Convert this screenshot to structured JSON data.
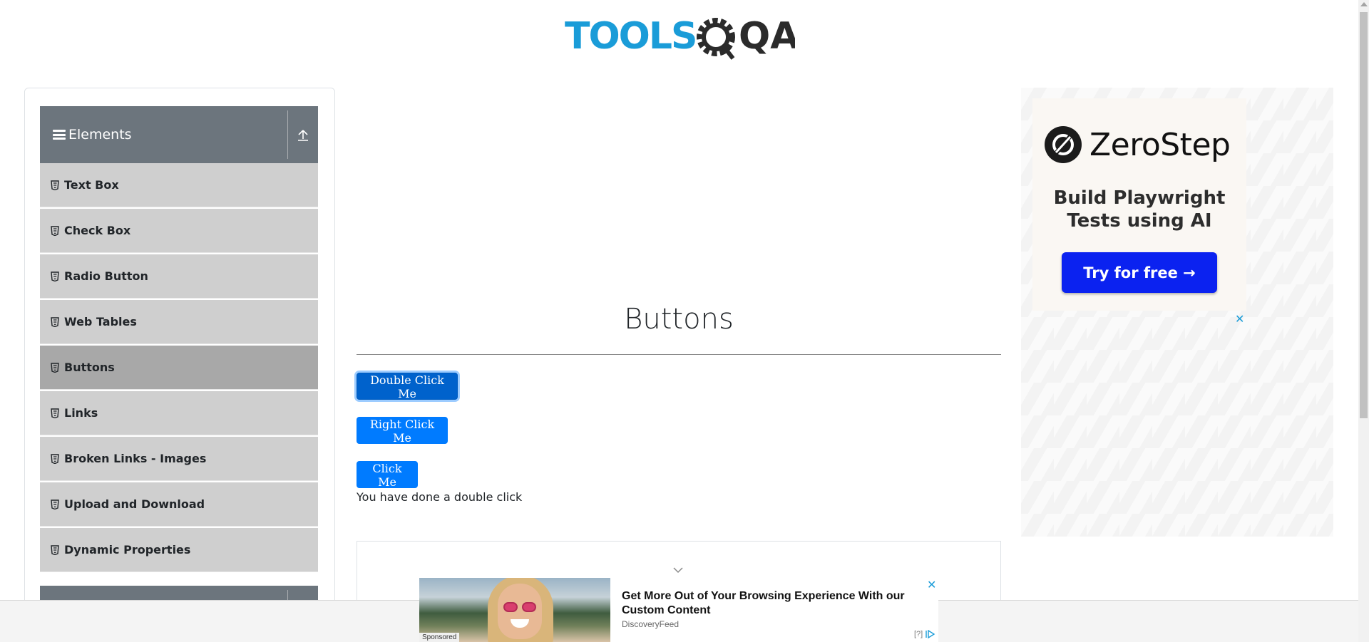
{
  "logo": {
    "text_tools": "TOOLS",
    "text_qa": "QA",
    "colors": {
      "tools": "#1a9cd8",
      "qa": "#2b2b2b"
    }
  },
  "sidebar": {
    "group_title": "Elements",
    "items": [
      {
        "label": "Text Box"
      },
      {
        "label": "Check Box"
      },
      {
        "label": "Radio Button"
      },
      {
        "label": "Web Tables"
      },
      {
        "label": "Buttons",
        "active": true
      },
      {
        "label": "Links"
      },
      {
        "label": "Broken Links - Images"
      },
      {
        "label": "Upload and Download"
      },
      {
        "label": "Dynamic Properties"
      }
    ]
  },
  "main": {
    "title": "Buttons",
    "buttons": {
      "double_click": "Double Click Me",
      "right_click": "Right Click Me",
      "click": "Click Me"
    },
    "result_message": "You have done a double click"
  },
  "right_ad": {
    "brand": "ZeroStep",
    "tagline": "Build Playwright Tests using AI",
    "cta": "Try for free →",
    "close": "✕"
  },
  "bottom_ad": {
    "title": "Get More Out of Your Browsing Experience With our Custom Content",
    "source": "DiscoveryFeed",
    "sponsored": "Sponsored",
    "close": "✕",
    "info": "[?]"
  },
  "colors": {
    "primary": "#007bff",
    "sidebar_header": "#6c757d",
    "menu_bg": "#cfcfcf",
    "menu_active": "#a8a8a8",
    "cta_blue": "#0b22f0"
  }
}
